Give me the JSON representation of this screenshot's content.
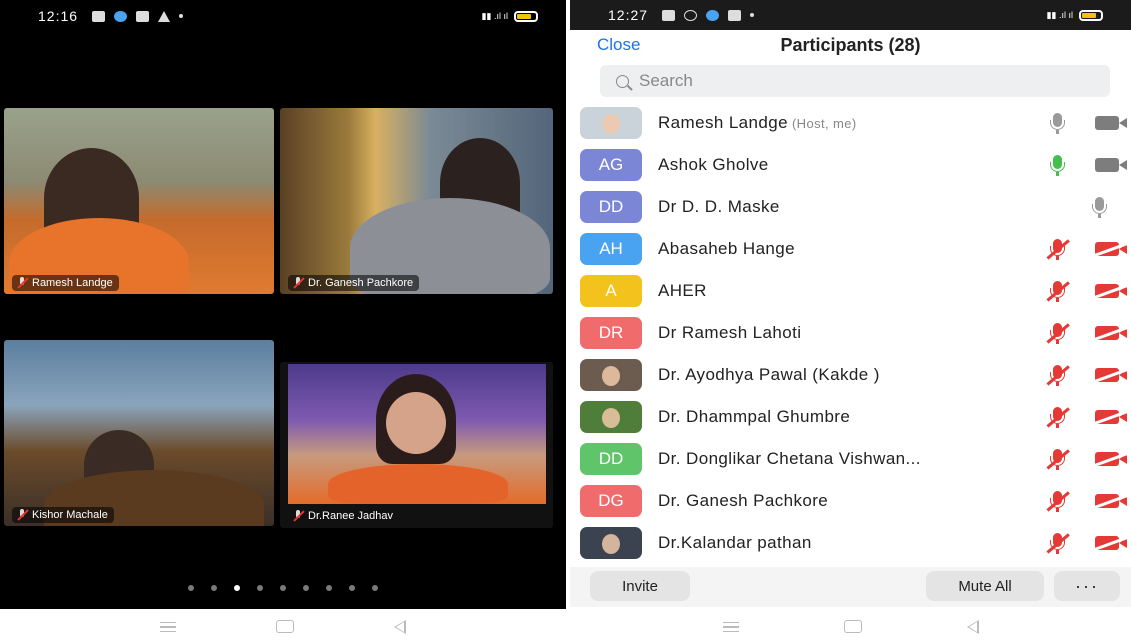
{
  "left_phone": {
    "status_time": "12:16",
    "tiles": [
      {
        "name": "Ramesh Landge"
      },
      {
        "name": "Dr. Ganesh Pachkore"
      },
      {
        "name": "Kishor Machale"
      },
      {
        "name": "Dr.Ranee Jadhav"
      }
    ],
    "page_dots": {
      "count": 9,
      "active_index": 2
    }
  },
  "right_phone": {
    "status_time": "12:27",
    "close_label": "Close",
    "title": "Participants (28)",
    "search_placeholder": "Search",
    "participants": [
      {
        "avatar_type": "photo",
        "avatar_color": "#c9d3d9",
        "initials": "",
        "name": "Ramesh Landge",
        "tag": "(Host, me)",
        "mic": "on",
        "cam": "on"
      },
      {
        "avatar_type": "initials",
        "avatar_color": "#7b86d6",
        "initials": "AG",
        "name": "Ashok Gholve",
        "tag": "",
        "mic": "active",
        "cam": "on"
      },
      {
        "avatar_type": "initials",
        "avatar_color": "#7b86d6",
        "initials": "DD",
        "name": "Dr D. D. Maske",
        "tag": "",
        "mic": "on",
        "cam": "none"
      },
      {
        "avatar_type": "initials",
        "avatar_color": "#4aa3f0",
        "initials": "AH",
        "name": "Abasaheb Hange",
        "tag": "",
        "mic": "off",
        "cam": "off"
      },
      {
        "avatar_type": "initials",
        "avatar_color": "#f4c21c",
        "initials": "A",
        "name": "AHER",
        "tag": "",
        "mic": "off",
        "cam": "off"
      },
      {
        "avatar_type": "initials",
        "avatar_color": "#f06b6b",
        "initials": "DR",
        "name": "Dr Ramesh Lahoti",
        "tag": "",
        "mic": "off",
        "cam": "off"
      },
      {
        "avatar_type": "photo",
        "avatar_color": "#6b5c4f",
        "initials": "",
        "name": "Dr. Ayodhya Pawal (Kakde )",
        "tag": "",
        "mic": "off",
        "cam": "off"
      },
      {
        "avatar_type": "photo",
        "avatar_color": "#4f7d3a",
        "initials": "",
        "name": "Dr. Dhammpal Ghumbre",
        "tag": "",
        "mic": "off",
        "cam": "off"
      },
      {
        "avatar_type": "initials",
        "avatar_color": "#5fc46a",
        "initials": "DD",
        "name": "Dr. Donglikar Chetana Vishwan...",
        "tag": "",
        "mic": "off",
        "cam": "off"
      },
      {
        "avatar_type": "initials",
        "avatar_color": "#f06b6b",
        "initials": "DG",
        "name": "Dr. Ganesh Pachkore",
        "tag": "",
        "mic": "off",
        "cam": "off"
      },
      {
        "avatar_type": "photo",
        "avatar_color": "#3b4250",
        "initials": "",
        "name": "Dr.Kalandar pathan",
        "tag": "",
        "mic": "off",
        "cam": "off"
      }
    ],
    "footer": {
      "invite_label": "Invite",
      "mute_all_label": "Mute All",
      "more_label": "···"
    }
  },
  "colors": {
    "accent_blue": "#1a73e8",
    "muted_red": "#e53935",
    "active_green": "#43c04c",
    "icon_gray": "#9a9a9a"
  }
}
